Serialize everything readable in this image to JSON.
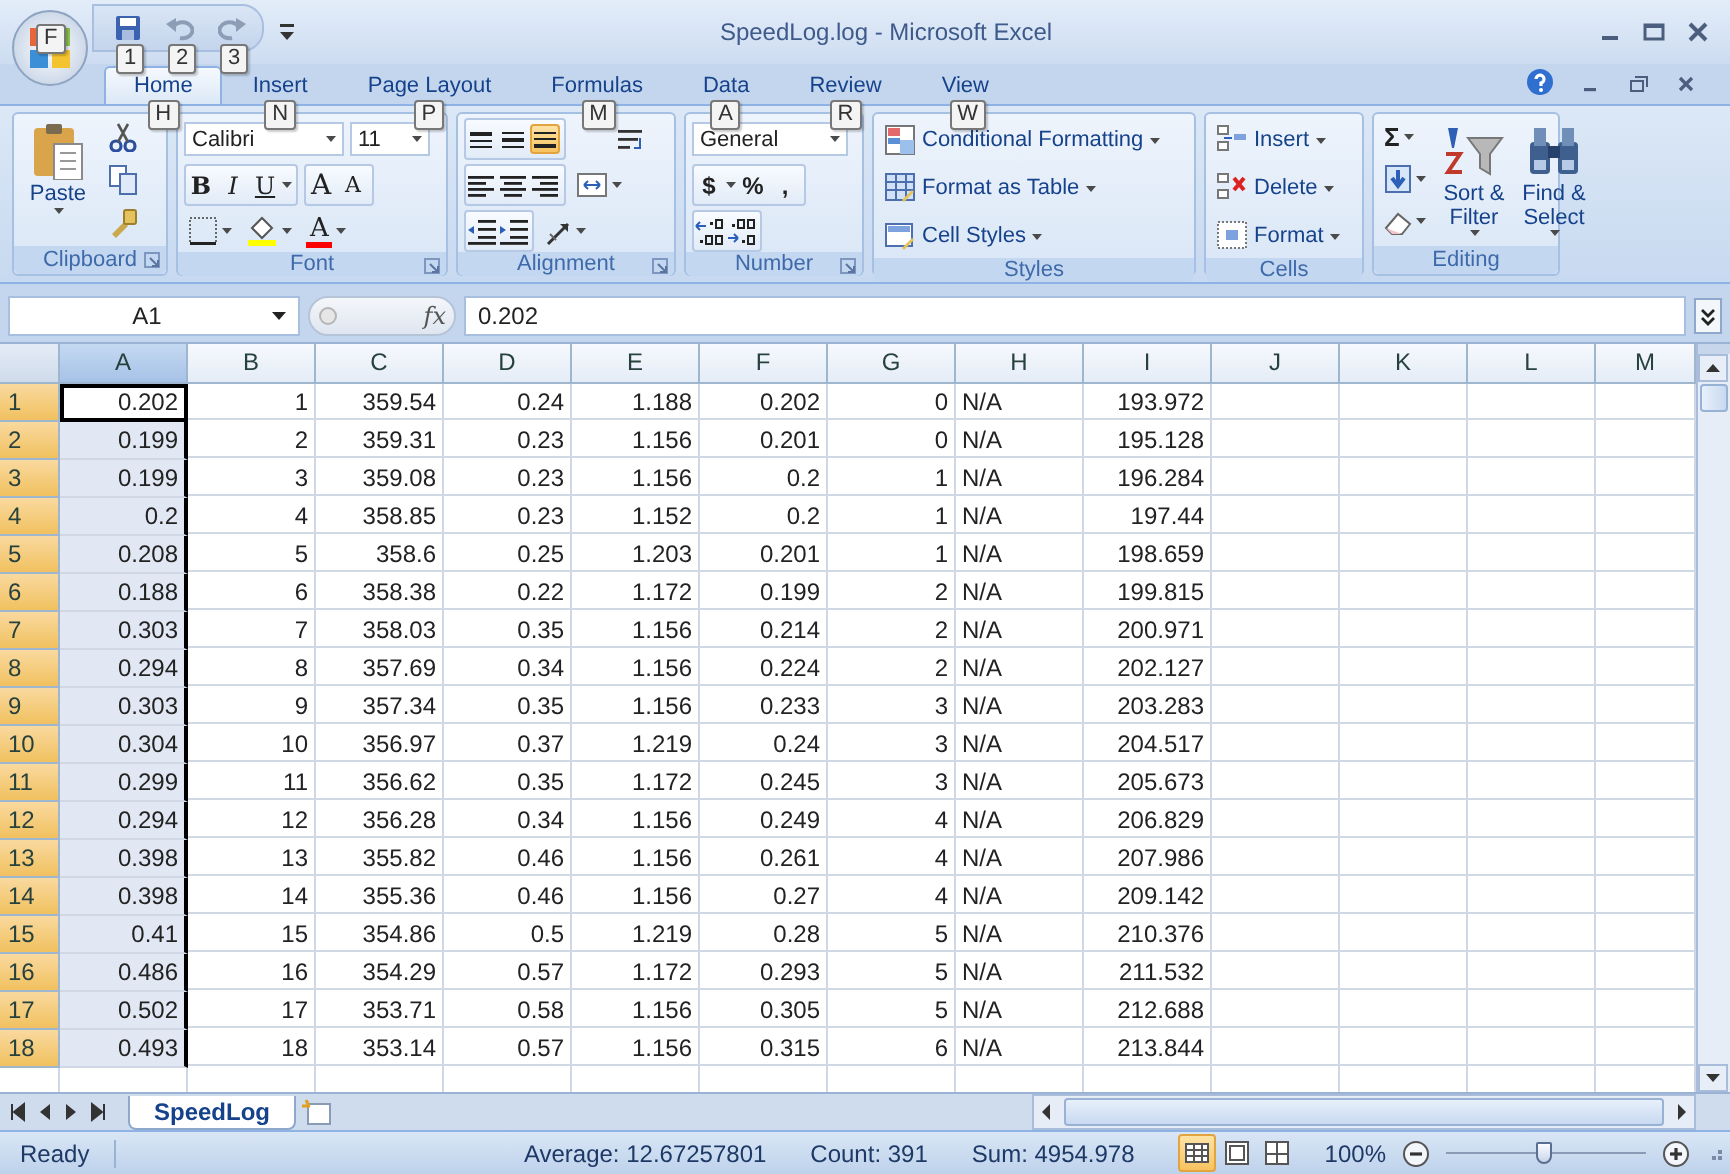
{
  "window": {
    "title": "SpeedLog.log - Microsoft Excel",
    "office_keytip": "F"
  },
  "quick_access": [
    {
      "kind": "save",
      "keytip": "1"
    },
    {
      "kind": "undo",
      "keytip": "2"
    },
    {
      "kind": "redo",
      "keytip": "3"
    }
  ],
  "tabs": [
    {
      "label": "Home",
      "keytip": "H",
      "selected": true
    },
    {
      "label": "Insert",
      "keytip": "N",
      "selected": false
    },
    {
      "label": "Page Layout",
      "keytip": "P",
      "selected": false
    },
    {
      "label": "Formulas",
      "keytip": "M",
      "selected": false
    },
    {
      "label": "Data",
      "keytip": "A",
      "selected": false
    },
    {
      "label": "Review",
      "keytip": "R",
      "selected": false
    },
    {
      "label": "View",
      "keytip": "W",
      "selected": false
    }
  ],
  "ribbon": {
    "groups": [
      {
        "kind": "clipboard",
        "label": "Clipboard",
        "paste_label": "Paste"
      },
      {
        "kind": "font",
        "label": "Font",
        "font_name": "Calibri",
        "font_size": "11",
        "style_buttons": [
          "B",
          "I",
          "U"
        ],
        "size_buttons": [
          "A",
          "A"
        ],
        "font_color_label": "A"
      },
      {
        "kind": "alignment",
        "label": "Alignment",
        "vertical_align": [
          {
            "selected": false
          },
          {
            "selected": false
          },
          {
            "selected": true
          }
        ]
      },
      {
        "kind": "number",
        "label": "Number",
        "format": "General",
        "symbols": [
          "$",
          "%",
          ","
        ]
      },
      {
        "kind": "styles",
        "label": "Styles",
        "commands": [
          "Conditional Formatting",
          "Format as Table",
          "Cell Styles"
        ]
      },
      {
        "kind": "cells",
        "label": "Cells",
        "commands": [
          "Insert",
          "Delete",
          "Format"
        ]
      },
      {
        "kind": "editing",
        "label": "Editing",
        "sum_symbol": "Σ",
        "commands": [
          "Sort & Filter",
          "Find & Select"
        ]
      }
    ]
  },
  "formula_bar": {
    "name_box": "A1",
    "function_label": "fx",
    "value": "0.202"
  },
  "sheet": {
    "columns": [
      {
        "label": "A",
        "selected": true,
        "kind": "number"
      },
      {
        "label": "B",
        "selected": false,
        "kind": "number"
      },
      {
        "label": "C",
        "selected": false,
        "kind": "number"
      },
      {
        "label": "D",
        "selected": false,
        "kind": "number"
      },
      {
        "label": "E",
        "selected": false,
        "kind": "number"
      },
      {
        "label": "F",
        "selected": false,
        "kind": "number"
      },
      {
        "label": "G",
        "selected": false,
        "kind": "number"
      },
      {
        "label": "H",
        "selected": false,
        "kind": "text"
      },
      {
        "label": "I",
        "selected": false,
        "kind": "number"
      },
      {
        "label": "J",
        "selected": false
      },
      {
        "label": "K",
        "selected": false
      },
      {
        "label": "L",
        "selected": false
      },
      {
        "label": "M",
        "selected": false
      }
    ],
    "rows": [
      {
        "label": "1",
        "selected": true,
        "cells": [
          "0.202",
          "1",
          "359.54",
          "0.24",
          "1.188",
          "0.202",
          "0",
          "N/A",
          "193.972"
        ]
      },
      {
        "label": "2",
        "selected": true,
        "cells": [
          "0.199",
          "2",
          "359.31",
          "0.23",
          "1.156",
          "0.201",
          "0",
          "N/A",
          "195.128"
        ]
      },
      {
        "label": "3",
        "selected": true,
        "cells": [
          "0.199",
          "3",
          "359.08",
          "0.23",
          "1.156",
          "0.2",
          "1",
          "N/A",
          "196.284"
        ]
      },
      {
        "label": "4",
        "selected": true,
        "cells": [
          "0.2",
          "4",
          "358.85",
          "0.23",
          "1.152",
          "0.2",
          "1",
          "N/A",
          "197.44"
        ]
      },
      {
        "label": "5",
        "selected": true,
        "cells": [
          "0.208",
          "5",
          "358.6",
          "0.25",
          "1.203",
          "0.201",
          "1",
          "N/A",
          "198.659"
        ]
      },
      {
        "label": "6",
        "selected": true,
        "cells": [
          "0.188",
          "6",
          "358.38",
          "0.22",
          "1.172",
          "0.199",
          "2",
          "N/A",
          "199.815"
        ]
      },
      {
        "label": "7",
        "selected": true,
        "cells": [
          "0.303",
          "7",
          "358.03",
          "0.35",
          "1.156",
          "0.214",
          "2",
          "N/A",
          "200.971"
        ]
      },
      {
        "label": "8",
        "selected": true,
        "cells": [
          "0.294",
          "8",
          "357.69",
          "0.34",
          "1.156",
          "0.224",
          "2",
          "N/A",
          "202.127"
        ]
      },
      {
        "label": "9",
        "selected": true,
        "cells": [
          "0.303",
          "9",
          "357.34",
          "0.35",
          "1.156",
          "0.233",
          "3",
          "N/A",
          "203.283"
        ]
      },
      {
        "label": "10",
        "selected": true,
        "cells": [
          "0.304",
          "10",
          "356.97",
          "0.37",
          "1.219",
          "0.24",
          "3",
          "N/A",
          "204.517"
        ]
      },
      {
        "label": "11",
        "selected": true,
        "cells": [
          "0.299",
          "11",
          "356.62",
          "0.35",
          "1.172",
          "0.245",
          "3",
          "N/A",
          "205.673"
        ]
      },
      {
        "label": "12",
        "selected": true,
        "cells": [
          "0.294",
          "12",
          "356.28",
          "0.34",
          "1.156",
          "0.249",
          "4",
          "N/A",
          "206.829"
        ]
      },
      {
        "label": "13",
        "selected": true,
        "cells": [
          "0.398",
          "13",
          "355.82",
          "0.46",
          "1.156",
          "0.261",
          "4",
          "N/A",
          "207.986"
        ]
      },
      {
        "label": "14",
        "selected": true,
        "cells": [
          "0.398",
          "14",
          "355.36",
          "0.46",
          "1.156",
          "0.27",
          "4",
          "N/A",
          "209.142"
        ]
      },
      {
        "label": "15",
        "selected": true,
        "cells": [
          "0.41",
          "15",
          "354.86",
          "0.5",
          "1.219",
          "0.28",
          "5",
          "N/A",
          "210.376"
        ]
      },
      {
        "label": "16",
        "selected": true,
        "cells": [
          "0.486",
          "16",
          "354.29",
          "0.57",
          "1.172",
          "0.293",
          "5",
          "N/A",
          "211.532"
        ]
      },
      {
        "label": "17",
        "selected": true,
        "cells": [
          "0.502",
          "17",
          "353.71",
          "0.58",
          "1.156",
          "0.305",
          "5",
          "N/A",
          "212.688"
        ]
      },
      {
        "label": "18",
        "selected": true,
        "cells": [
          "0.493",
          "18",
          "353.14",
          "0.57",
          "1.156",
          "0.315",
          "6",
          "N/A",
          "213.844"
        ]
      }
    ]
  },
  "sheet_tabs": [
    {
      "label": "SpeedLog",
      "selected": true
    }
  ],
  "status_bar": {
    "mode": "Ready",
    "average": "Average: 12.67257801",
    "count": "Count: 391",
    "sum": "Sum: 4954.978",
    "view_buttons": [
      {
        "selected": true
      },
      {
        "selected": false
      },
      {
        "selected": false
      }
    ],
    "zoom": "100%",
    "zoom_slider": {
      "level": 0.49
    }
  }
}
